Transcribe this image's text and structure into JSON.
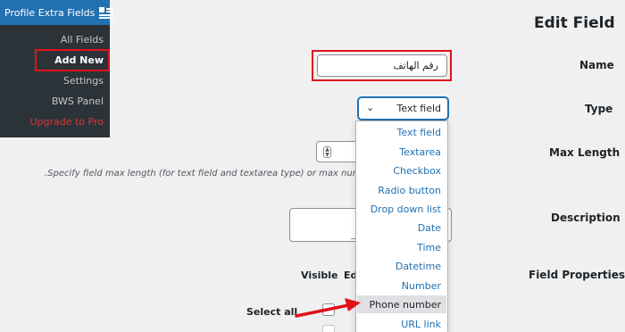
{
  "sidebar": {
    "title": "Profile Extra Fields",
    "items": [
      {
        "label": "All Fields"
      },
      {
        "label": "Add New"
      },
      {
        "label": "Settings"
      },
      {
        "label": "BWS Panel"
      },
      {
        "label": "Upgrade to Pro"
      }
    ]
  },
  "page": {
    "title": "Edit Field"
  },
  "form": {
    "name_label": "Name",
    "name_value": "رقم الهاتف",
    "type_label": "Type",
    "type_value": "Text field",
    "max_length_label": "Max Length",
    "max_length_help": ".Specify field max length (for text field and textarea type) or max number",
    "description_label": "Description",
    "field_properties_label": "Field Properties",
    "col_visible": "Visible",
    "col_editable": "Ed",
    "select_all": "Select all"
  },
  "type_options": [
    {
      "label": "Text field"
    },
    {
      "label": "Textarea"
    },
    {
      "label": "Checkbox"
    },
    {
      "label": "Radio button"
    },
    {
      "label": "Drop down list"
    },
    {
      "label": "Date"
    },
    {
      "label": "Time"
    },
    {
      "label": "Datetime"
    },
    {
      "label": "Number"
    },
    {
      "label": "Phone number"
    },
    {
      "label": "URL link"
    }
  ],
  "hovered_option": "Phone number",
  "colors": {
    "sidebar_bg": "#2c3338",
    "sidebar_header": "#2271b1",
    "highlight": "#e0111b",
    "link": "#2271b1",
    "upgrade": "#d63638"
  }
}
